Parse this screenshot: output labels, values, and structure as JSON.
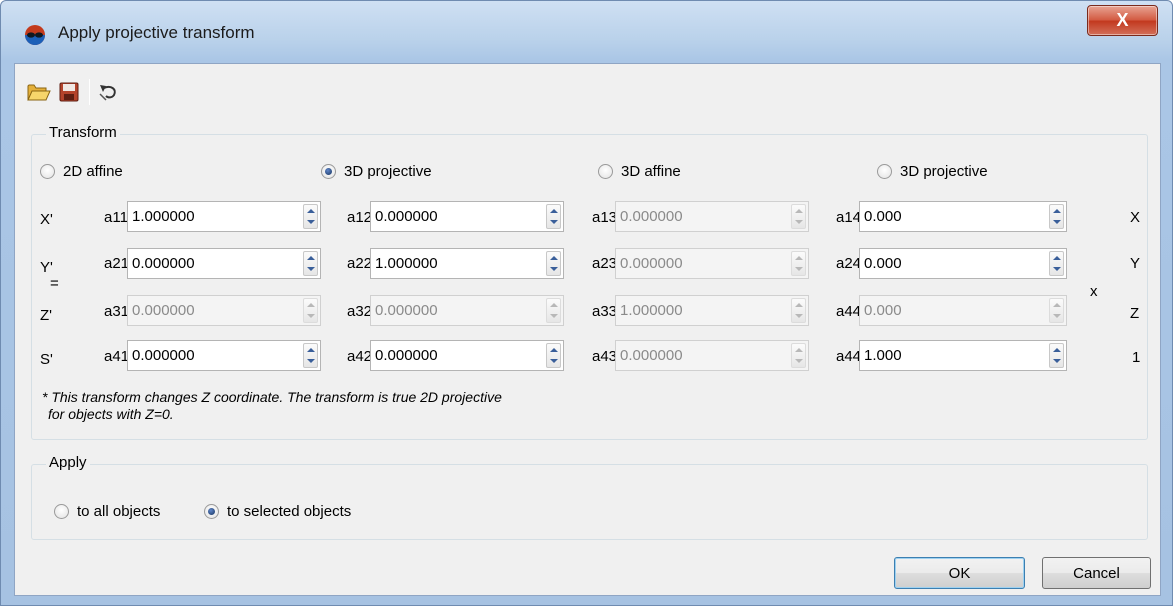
{
  "window": {
    "title": "Apply projective transform",
    "close_label": "X"
  },
  "toolbar": {
    "open_icon": "folder-open-icon",
    "save_icon": "floppy-disk-icon",
    "reset_icon": "undo-icon"
  },
  "transform": {
    "group_label": "Transform",
    "modes": [
      {
        "label": "2D affine",
        "checked": false
      },
      {
        "label": "3D projective",
        "checked": true
      },
      {
        "label": "3D affine",
        "checked": false
      },
      {
        "label": "3D projective",
        "checked": false
      }
    ],
    "left_vars": [
      "X'",
      "Y'",
      "Z'",
      "S'"
    ],
    "equals": "=",
    "times": "x",
    "right_vars": [
      "X",
      "Y",
      "Z",
      "1"
    ],
    "matrix": [
      [
        {
          "label": "a11",
          "value": "1.000000",
          "enabled": true
        },
        {
          "label": "a12",
          "value": "0.000000",
          "enabled": true
        },
        {
          "label": "a13",
          "value": "0.000000",
          "enabled": false
        },
        {
          "label": "a14",
          "value": "0.000",
          "enabled": true
        }
      ],
      [
        {
          "label": "a21",
          "value": "0.000000",
          "enabled": true
        },
        {
          "label": "a22",
          "value": "1.000000",
          "enabled": true
        },
        {
          "label": "a23",
          "value": "0.000000",
          "enabled": false
        },
        {
          "label": "a24",
          "value": "0.000",
          "enabled": true
        }
      ],
      [
        {
          "label": "a31",
          "value": "0.000000",
          "enabled": false
        },
        {
          "label": "a32",
          "value": "0.000000",
          "enabled": false
        },
        {
          "label": "a33",
          "value": "1.000000",
          "enabled": false
        },
        {
          "label": "a44",
          "value": "0.000",
          "enabled": false
        }
      ],
      [
        {
          "label": "a41",
          "value": "0.000000",
          "enabled": true
        },
        {
          "label": "a42",
          "value": "0.000000",
          "enabled": true
        },
        {
          "label": "a43",
          "value": "0.000000",
          "enabled": false
        },
        {
          "label": "a44",
          "value": "1.000",
          "enabled": true
        }
      ]
    ],
    "note_line1": "* This transform changes Z coordinate. The transform is true 2D projective",
    "note_line2": "for objects with Z=0."
  },
  "apply": {
    "group_label": "Apply",
    "options": [
      {
        "label": "to all objects",
        "checked": false
      },
      {
        "label": "to selected objects",
        "checked": true
      }
    ]
  },
  "buttons": {
    "ok": "OK",
    "cancel": "Cancel"
  }
}
